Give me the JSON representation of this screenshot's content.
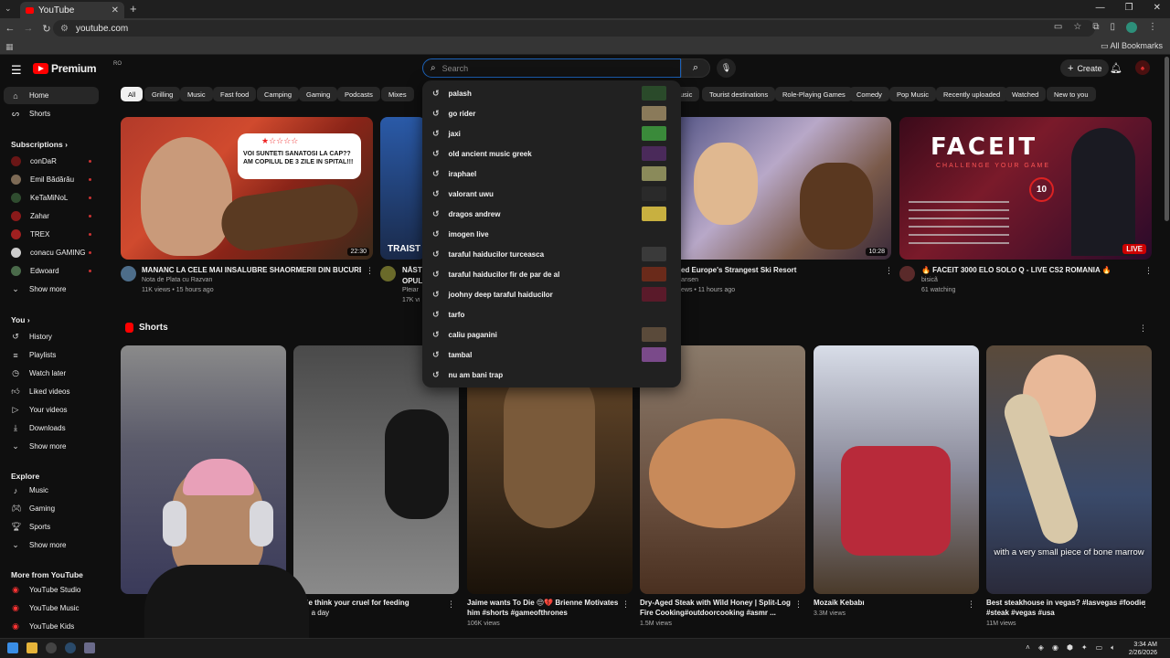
{
  "browser": {
    "tab_title": "YouTube",
    "url": "youtube.com",
    "all_bookmarks": "All Bookmarks"
  },
  "masthead": {
    "logo": "Premium",
    "logo_sup": "RO",
    "search_placeholder": "Search",
    "create": "Create"
  },
  "sidebar": {
    "home": "Home",
    "shorts": "Shorts",
    "subscriptions": "Subscriptions",
    "channels": [
      "conDaR",
      "Emil Bădărău",
      "KeTaMiNoL",
      "Zahar",
      "TREX",
      "conacu GAMING",
      "Edwoard"
    ],
    "show_more": "Show more",
    "you": "You",
    "you_items": [
      "History",
      "Playlists",
      "Watch later",
      "Liked videos",
      "Your videos",
      "Downloads"
    ],
    "explore": "Explore",
    "explore_items": [
      "Music",
      "Gaming",
      "Sports"
    ],
    "more_from": "More from YouTube",
    "more_items": [
      "YouTube Studio",
      "YouTube Music",
      "YouTube Kids"
    ]
  },
  "chips": [
    "All",
    "Grilling",
    "Music",
    "Fast food",
    "Camping",
    "Gaming",
    "Podcasts",
    "Mixes",
    "usic",
    "Tourist destinations",
    "Role-Playing Games",
    "Comedy",
    "Pop Music",
    "Recently uploaded",
    "Watched",
    "New to you"
  ],
  "suggestions": [
    "palash",
    "go rider",
    "jaxi",
    "old ancient music greek",
    "iraphael",
    "valorant uwu",
    "dragos andrew",
    "imogen live",
    "taraful haiducilor turceasca",
    "taraful haiducilor fir de par de al",
    "joohny deep taraful haiducilor",
    "tarfo",
    "caliu paganini",
    "tambal",
    "nu am bani trap"
  ],
  "videos": [
    {
      "title": "MANANC LA CELE MAI INSALUBRE SHAORMERII DIN BUCURESTI",
      "channel": "Nota de Plata cu Razvan",
      "meta": "11K views • 15 hours ago",
      "duration": "22:30",
      "thumb_text_1": "VOI SUNTETI SANATOSI LA CAP??",
      "thumb_text_2": "AM COPILUL DE 3 ZILE IN SPITAL!!!"
    },
    {
      "title": "NĂST",
      "line2": "OPUL",
      "channel": "Pleiar",
      "meta": "17K vi",
      "thumb_text": "TRAIST"
    },
    {
      "title": "ed Europe's Strangest Ski Resort",
      "channel": "ansen",
      "meta": "ews • 11 hours ago",
      "duration": "10:28"
    },
    {
      "title": "🔥 FACEIT 3000 ELO SOLO Q - LIVE CS2 ROMANIA 🔥",
      "channel": "bisicã",
      "meta": "61 watching",
      "live": "LIVE",
      "thumb_text": "FACEIT",
      "thumb_sub": "CHALLENGE YOUR GAME",
      "thumb_num": "10"
    }
  ],
  "shorts_title": "Shorts",
  "shorts": [
    {
      "title": "",
      "views": ""
    },
    {
      "title": "eople think your cruel for feeding",
      "line2": "once a day",
      "views": ""
    },
    {
      "title": "Jaime wants To Die 😔💔 Brienne Motivates",
      "line2": "him #shorts #gameofthrones",
      "views": "106K views"
    },
    {
      "title": "Dry-Aged Steak with Wild Honey | Split-Log",
      "line2": "Fire Cooking#outdoorcooking  #asmr ...",
      "views": "1.5M views"
    },
    {
      "title": "Mozaik Kebabı",
      "views": "3.3M views"
    },
    {
      "title": "Best steakhouse in vegas? #lasvegas #foodie",
      "line2": "#steak #vegas #usa",
      "views": "11M views",
      "caption": "with a very small piece of bone marrow"
    }
  ],
  "taskbar": {
    "time": "3:34 AM",
    "date": "2/26/2026"
  }
}
